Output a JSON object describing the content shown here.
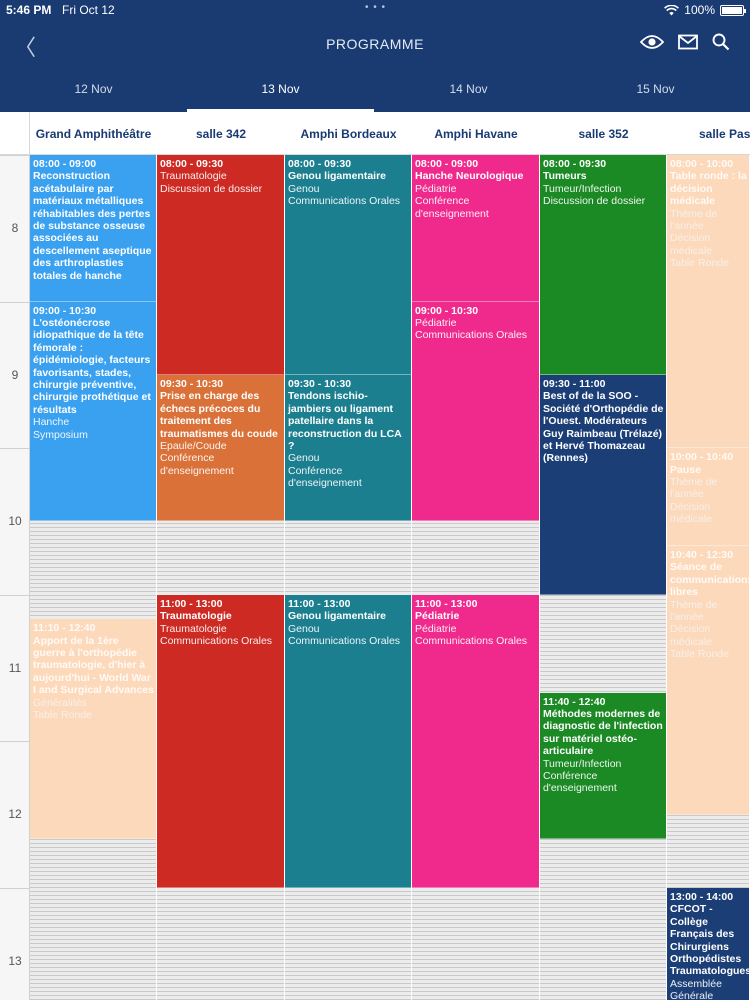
{
  "status_bar": {
    "time": "5:46 PM",
    "date": "Fri Oct 12",
    "battery": "100%"
  },
  "nav": {
    "title": "PROGRAMME",
    "back_glyph": "〈"
  },
  "days": [
    "12 Nov",
    "13 Nov",
    "14 Nov",
    "15 Nov"
  ],
  "active_day_index": 1,
  "rooms": [
    "Grand Amphithéâtre",
    "salle 342",
    "Amphi Bordeaux",
    "Amphi Havane",
    "salle 352",
    "salle Pas"
  ],
  "hours": [
    "8",
    "9",
    "10",
    "11",
    "12",
    "13"
  ],
  "colors": {
    "nav_blue": "#1a3a72",
    "blue": "#3aa1f0",
    "red": "#cc2a23",
    "orange": "#d97139",
    "teal": "#1b7f90",
    "pink": "#f02a8c",
    "green": "#1b8a25",
    "navy": "#1c3e76",
    "peach": "#fcd9bb"
  },
  "events": [
    {
      "room": 0,
      "time": "08:00 - 09:00",
      "title": "Reconstruction acétabulaire par matériaux métalliques réhabitables des pertes de substance osseuse associées au descellement aseptique des arthroplasties totales de hanche",
      "lines": [],
      "color": "blue"
    },
    {
      "room": 0,
      "time": "09:00 - 10:30",
      "title": "L'ostéonécrose idiopathique de la tête fémorale : épidémiologie, facteurs favorisants, stades, chirurgie préventive, chirurgie prothétique et résultats",
      "lines": [
        "Hanche",
        "Symposium"
      ],
      "color": "blue"
    },
    {
      "room": 0,
      "time": "11:10 - 12:40",
      "title": "Apport de la 1ère guerre à l'orthopédie traumatologie, d'hier à aujourd'hui - World War I and Surgical Advances",
      "lines": [
        "Généralités",
        "Table Ronde"
      ],
      "color": "peach"
    },
    {
      "room": 1,
      "time": "08:00 - 09:30",
      "title": "",
      "lines": [
        "Traumatologie",
        "Discussion de dossier"
      ],
      "color": "red"
    },
    {
      "room": 1,
      "time": "09:30 - 10:30",
      "title": "Prise en charge des échecs précoces du traitement des traumatismes du coude",
      "lines": [
        "Epaule/Coude",
        "Conférence d'enseignement"
      ],
      "color": "orange"
    },
    {
      "room": 1,
      "time": "11:00 - 13:00",
      "title": "Traumatologie",
      "lines": [
        "Traumatologie",
        "Communications Orales"
      ],
      "color": "red"
    },
    {
      "room": 2,
      "time": "08:00 - 09:30",
      "title": "Genou ligamentaire",
      "lines": [
        "Genou",
        "Communications Orales"
      ],
      "color": "teal"
    },
    {
      "room": 2,
      "time": "09:30 - 10:30",
      "title": "Tendons ischio-jambiers ou ligament patellaire dans la reconstruction du LCA ?",
      "lines": [
        "Genou",
        "Conférence d'enseignement"
      ],
      "color": "teal"
    },
    {
      "room": 2,
      "time": "11:00 - 13:00",
      "title": "Genou ligamentaire",
      "lines": [
        "Genou",
        "Communications Orales"
      ],
      "color": "teal"
    },
    {
      "room": 3,
      "time": "08:00 - 09:00",
      "title": "Hanche Neurologique",
      "lines": [
        "Pédiatrie",
        "Conférence d'enseignement"
      ],
      "color": "pink"
    },
    {
      "room": 3,
      "time": "09:00 - 10:30",
      "title": "",
      "lines": [
        "Pédiatrie",
        "Communications Orales"
      ],
      "color": "pink"
    },
    {
      "room": 3,
      "time": "11:00 - 13:00",
      "title": "Pédiatrie",
      "lines": [
        "Pédiatrie",
        "Communications Orales"
      ],
      "color": "pink"
    },
    {
      "room": 4,
      "time": "08:00 - 09:30",
      "title": "Tumeurs",
      "lines": [
        "Tumeur/Infection",
        "Discussion de dossier"
      ],
      "color": "green"
    },
    {
      "room": 4,
      "time": "09:30 - 11:00",
      "title": "Best of de la SOO - Société d'Orthopédie de l'Ouest. Modérateurs Guy Raimbeau (Trélazé) et Hervé Thomazeau (Rennes)",
      "lines": [],
      "color": "navy"
    },
    {
      "room": 4,
      "time": "11:40 - 12:40",
      "title": "Méthodes modernes de diagnostic de l'infection sur matériel ostéo-articulaire",
      "lines": [
        "Tumeur/Infection",
        "Conférence d'enseignement"
      ],
      "color": "green"
    },
    {
      "room": 5,
      "time": "08:00 - 10:00",
      "title": "Table ronde : la décision médicale",
      "lines": [
        "Thème de l'année",
        "Décision médicale",
        "Table Ronde"
      ],
      "color": "peach"
    },
    {
      "room": 5,
      "time": "10:00 - 10:40",
      "title": "Pause",
      "lines": [
        "Thème de l'année",
        "Décision médicale"
      ],
      "color": "peach"
    },
    {
      "room": 5,
      "time": "10:40 - 12:30",
      "title": "Séance de communications libres",
      "lines": [
        "Thème de l'année",
        "Décision médicale",
        "Table Ronde"
      ],
      "color": "peach"
    },
    {
      "room": 5,
      "time": "13:00 - 14:00",
      "title": "CFCOT - Collège Français des Chirurgiens Orthopédistes Traumatologues",
      "lines": [
        "Assemblée",
        "Générale CFCOT"
      ],
      "color": "navy"
    }
  ]
}
